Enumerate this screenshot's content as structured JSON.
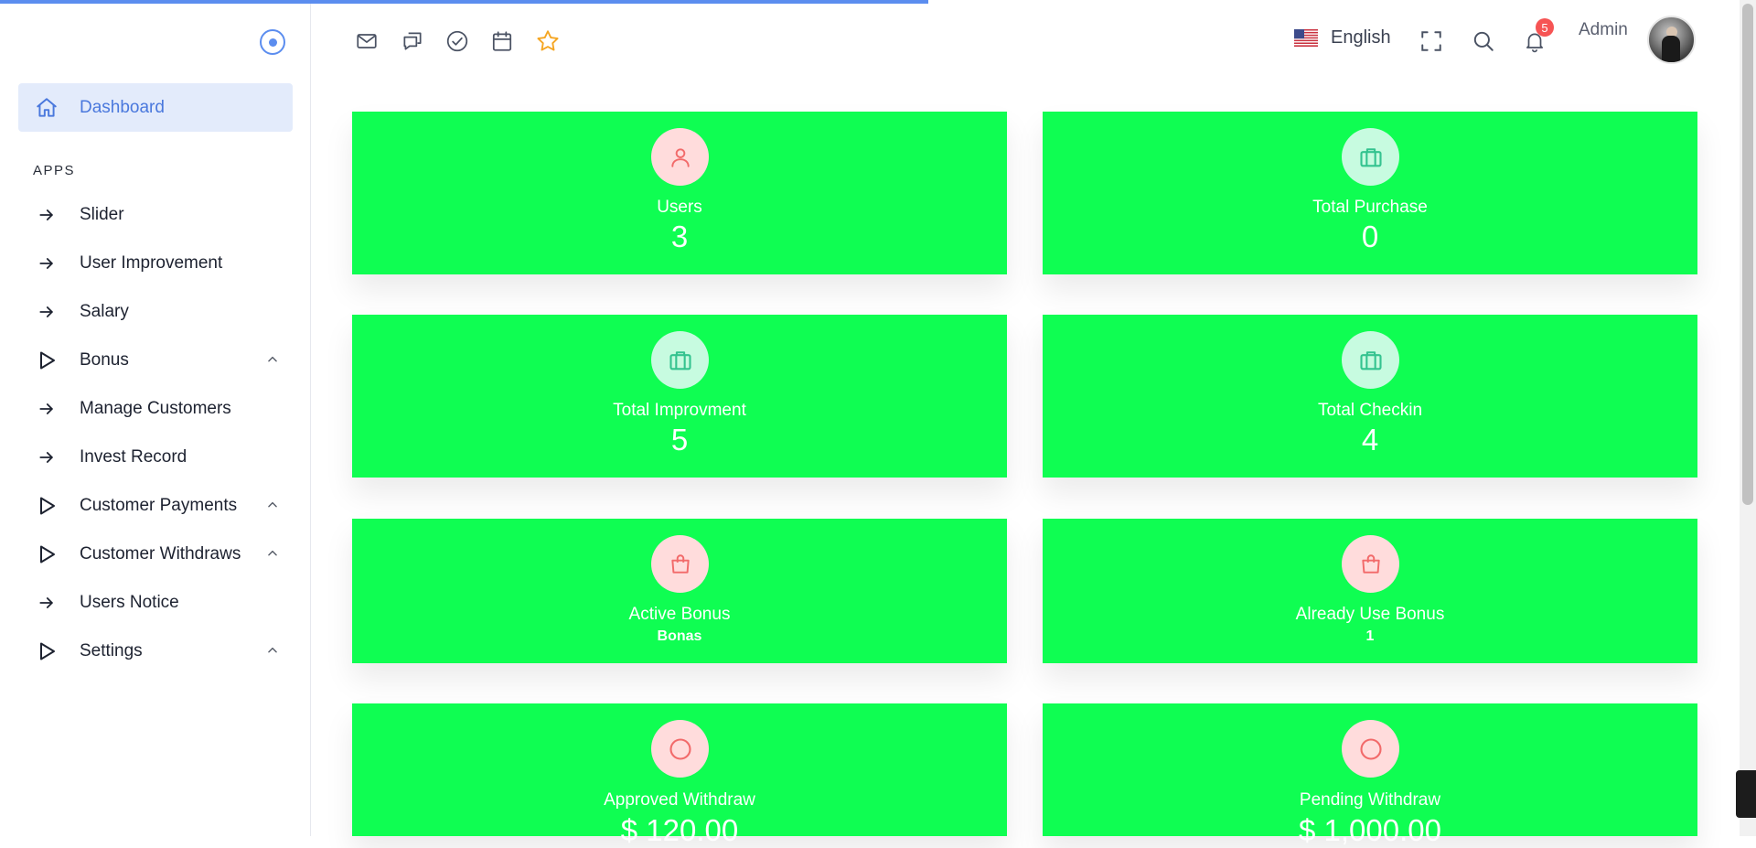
{
  "sidebar": {
    "active_item": {
      "label": "Dashboard",
      "icon": "home-icon"
    },
    "section_title": "APPS",
    "items": [
      {
        "label": "Slider",
        "icon": "arrow-right-icon",
        "has_chevron": false
      },
      {
        "label": "User Improvement",
        "icon": "arrow-right-icon",
        "has_chevron": false
      },
      {
        "label": "Salary",
        "icon": "arrow-right-icon",
        "has_chevron": false
      },
      {
        "label": "Bonus",
        "icon": "play-icon",
        "has_chevron": true
      },
      {
        "label": "Manage Customers",
        "icon": "arrow-right-icon",
        "has_chevron": false
      },
      {
        "label": "Invest Record",
        "icon": "arrow-right-icon",
        "has_chevron": false
      },
      {
        "label": "Customer Payments",
        "icon": "play-icon",
        "has_chevron": true
      },
      {
        "label": "Customer Withdraws",
        "icon": "play-icon",
        "has_chevron": true
      },
      {
        "label": "Users Notice",
        "icon": "arrow-right-icon",
        "has_chevron": false
      },
      {
        "label": "Settings",
        "icon": "play-icon",
        "has_chevron": true
      }
    ]
  },
  "topbar": {
    "shortcut_icons": [
      "mail-icon",
      "chat-icon",
      "check-circle-icon",
      "calendar-icon",
      "star-icon"
    ],
    "language": "English",
    "notification_count": "5",
    "user_name": "Admin"
  },
  "cards": [
    {
      "title": "Users",
      "value": "3",
      "icon": "user-icon",
      "tone": "red"
    },
    {
      "title": "Total Purchase",
      "value": "0",
      "icon": "briefcase-icon",
      "tone": "green"
    },
    {
      "title": "Total Improvment",
      "value": "5",
      "icon": "briefcase-icon",
      "tone": "green"
    },
    {
      "title": "Total Checkin",
      "value": "4",
      "icon": "briefcase-icon",
      "tone": "green"
    },
    {
      "title": "Active Bonus",
      "value": "Bonas",
      "icon": "shopping-bag-icon",
      "tone": "red"
    },
    {
      "title": "Already Use Bonus",
      "value": "1",
      "icon": "shopping-bag-icon",
      "tone": "red"
    },
    {
      "title": "Approved Withdraw",
      "value": "$ 120.00",
      "icon": "circle-icon",
      "tone": "red"
    },
    {
      "title": "Pending Withdraw",
      "value": "$ 1,000.00",
      "icon": "circle-icon",
      "tone": "red"
    }
  ],
  "colors": {
    "accent": "#5b8def",
    "card_background": "#0ffe52",
    "badge": "#f65454",
    "icon_red": "#f26a6a",
    "icon_green": "#34c38f"
  }
}
